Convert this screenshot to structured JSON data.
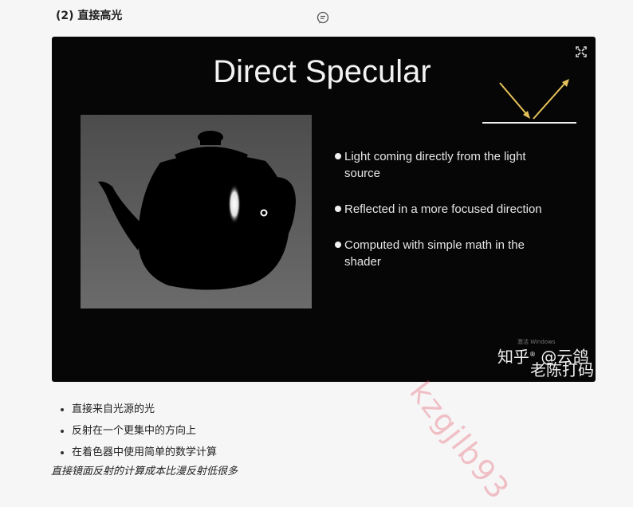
{
  "heading": "(2) 直接高光",
  "slide": {
    "title": "Direct Specular",
    "bullets": [
      "Light coming directly from the light source",
      "Reflected in a more focused direction",
      "Computed with simple math in the shader"
    ],
    "os_overlay": "激活 Windows",
    "logo": {
      "brand": "知乎",
      "registered": "®",
      "handle": "@云鸽",
      "sub": "老陈打码"
    }
  },
  "watermark": "kzgjlb93",
  "notes": [
    "直接来自光源的光",
    "反射在一个更集中的方向上",
    "在着色器中使用简单的数学计算"
  ],
  "summary": "直接镜面反射的计算成本比漫反射低很多",
  "colors": {
    "slide_bg": "#060606",
    "ray": "#e6c25a",
    "watermark": "#e65a6e"
  },
  "icons": {
    "comment": "comment-icon",
    "expand": "expand-icon"
  }
}
